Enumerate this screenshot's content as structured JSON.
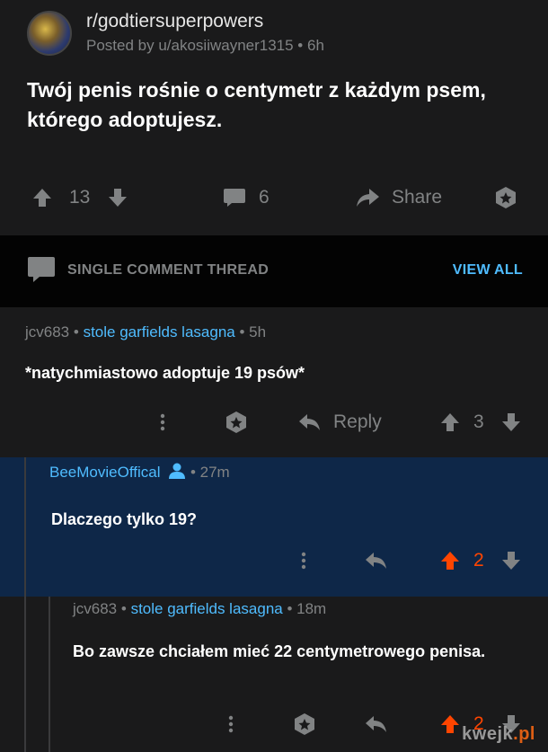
{
  "post": {
    "subreddit": "r/godtiersuperpowers",
    "posted_by": "Posted by u/akosiiwayner1315 • 6h",
    "title": "Twój penis rośnie o centymetr z każdym psem, którego adoptujesz.",
    "score": "13",
    "comments": "6",
    "share_label": "Share"
  },
  "thread": {
    "label": "SINGLE COMMENT THREAD",
    "view_all": "VIEW ALL"
  },
  "comments": [
    {
      "author": "jcv683",
      "separator": "•",
      "flair": "stole garfields lasagna",
      "time": "• 5h",
      "body": "*natychmiastowo adoptuje 19 psów*",
      "reply_label": "Reply",
      "score": "3"
    },
    {
      "author": "BeeMovieOffical",
      "time": "• 27m",
      "body": "Dlaczego tylko 19?",
      "score": "2"
    },
    {
      "author": "jcv683",
      "separator": "•",
      "flair": "stole garfields lasagna",
      "time": "• 18m",
      "body": "Bo zawsze chciałem mieć 22 centymetrowego penisa.",
      "score": "2"
    }
  ],
  "watermark": {
    "brand": "kwejk",
    "domain": ".pl"
  },
  "colors": {
    "background": "#1a1a1b",
    "highlight": "#0e2748",
    "accent": "#4fbcff",
    "upvoted": "#ff4500"
  }
}
